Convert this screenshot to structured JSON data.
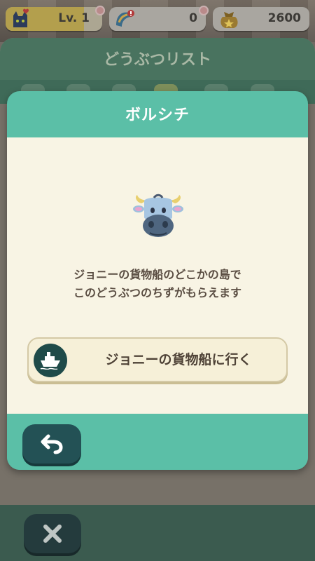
{
  "status": {
    "level_label": "Lv. 1",
    "tickets_value": "0",
    "bells_value": "2600"
  },
  "background": {
    "list_title": "どうぶつリスト"
  },
  "dialog": {
    "title": "ボルシチ",
    "description_line1": "ジョニーの貨物船のどこかの島で",
    "description_line2": "このどうぶつのちずがもらえます",
    "goto_button_label": "ジョニーの貨物船に行く"
  },
  "icons": {
    "level": "cat-heart-icon",
    "tickets": "leaf-ticket-icon",
    "bells": "bell-bag-icon",
    "animal": "cow-villager-icon",
    "goto": "boat-icon",
    "back": "back-arrow-icon",
    "close": "close-x-icon"
  },
  "colors": {
    "dialog_header": "#5bbfa7",
    "dialog_body": "#f8f4e4",
    "button_dark": "#235155"
  }
}
